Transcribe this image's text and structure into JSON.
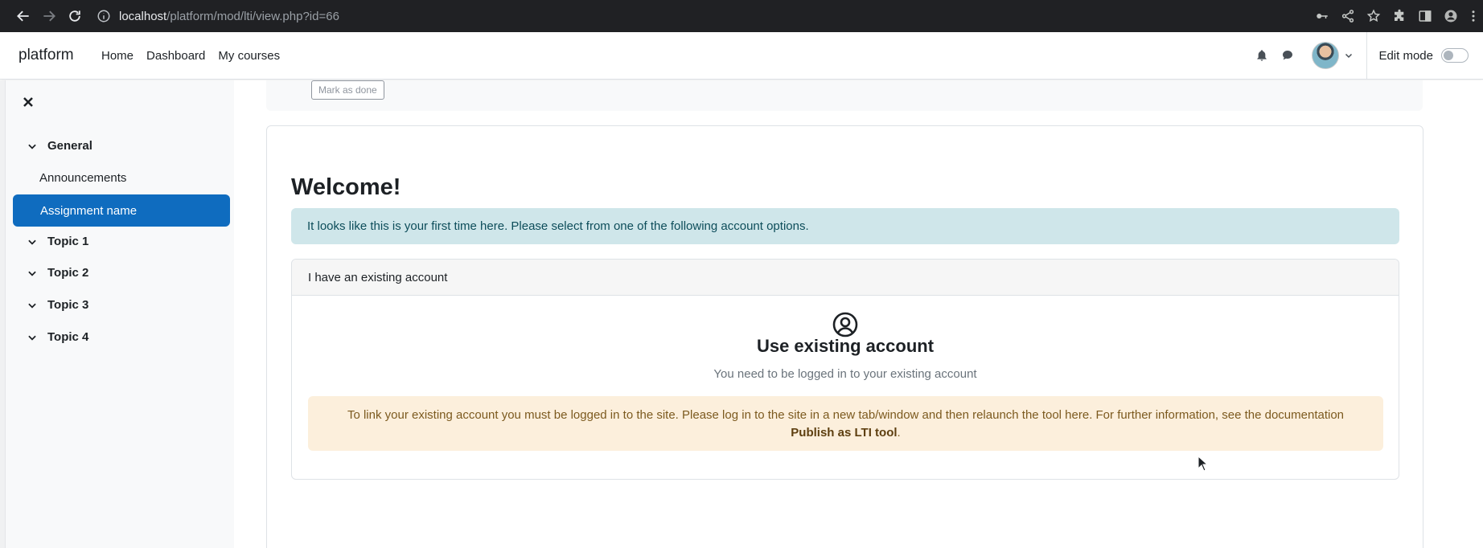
{
  "browser": {
    "url_host": "localhost",
    "url_path": "/platform/mod/lti/view.php?id=66"
  },
  "navbar": {
    "brand": "platform",
    "links": [
      "Home",
      "Dashboard",
      "My courses"
    ],
    "edit_mode_label": "Edit mode",
    "edit_mode_on": false
  },
  "course_index": {
    "sections": [
      {
        "title": "General",
        "items": [
          "Announcements",
          "Assignment name"
        ]
      },
      {
        "title": "Topic 1",
        "items": []
      },
      {
        "title": "Topic 2",
        "items": []
      },
      {
        "title": "Topic 3",
        "items": []
      },
      {
        "title": "Topic 4",
        "items": []
      }
    ],
    "active_item": "Assignment name"
  },
  "activity": {
    "mark_done_label": "Mark as done"
  },
  "main": {
    "heading": "Welcome!",
    "info_alert": "It looks like this is your first time here. Please select from one of the following account options.",
    "card": {
      "header": "I have an existing account",
      "title": "Use existing account",
      "text": "You need to be logged in to your existing account",
      "warning_text": "To link your existing account you must be logged in to the site. Please log in to the site in a new tab/window and then relaunch the tool here. For further information, see the documentation",
      "warning_link": "Publish as LTI tool",
      "warning_end": "."
    }
  },
  "icons": {
    "back": "arrow-left-icon",
    "forward": "arrow-right-icon",
    "reload": "reload-icon",
    "info": "info-icon",
    "key": "key-icon",
    "share": "share-icon",
    "star": "star-icon",
    "extensions": "puzzle-icon",
    "sidepanel": "side-panel-icon",
    "profile": "profile-icon",
    "menu": "kebab-menu-icon",
    "bell": "bell-icon",
    "chat": "chat-icon",
    "close": "close-icon",
    "user_circle": "user-circle-icon"
  },
  "colors": {
    "primary": "#0f6cbf",
    "info_bg": "#cfe6ea",
    "warning_bg": "#fcefdc"
  }
}
